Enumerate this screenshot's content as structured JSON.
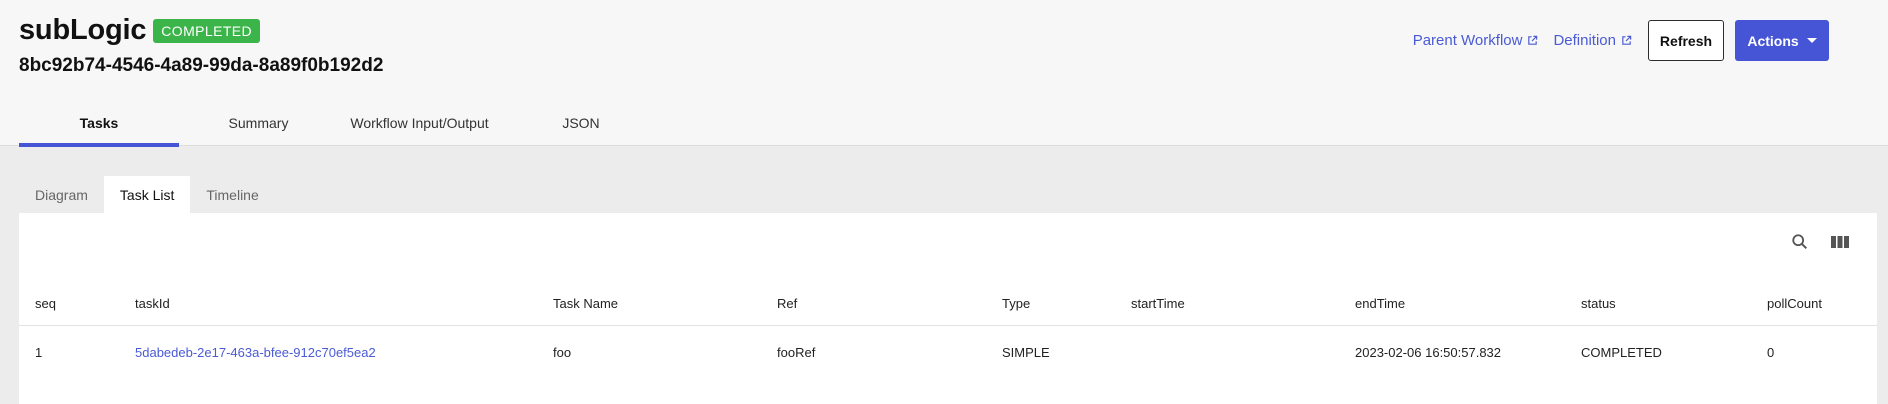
{
  "workflow": {
    "name": "subLogic",
    "status": "COMPLETED",
    "id": "8bc92b74-4546-4a89-99da-8a89f0b192d2"
  },
  "header_actions": {
    "parent_workflow": "Parent Workflow",
    "definition": "Definition",
    "refresh": "Refresh",
    "actions": "Actions"
  },
  "main_tabs": [
    "Tasks",
    "Summary",
    "Workflow Input/Output",
    "JSON"
  ],
  "sub_tabs": [
    "Diagram",
    "Task List",
    "Timeline"
  ],
  "toolbar": {
    "search_icon": "search-icon",
    "columns_icon": "view-column-icon"
  },
  "table": {
    "columns": [
      "seq",
      "taskId",
      "Task Name",
      "Ref",
      "Type",
      "startTime",
      "endTime",
      "status",
      "pollCount"
    ],
    "rows": [
      {
        "seq": "1",
        "taskId": "5dabedeb-2e17-463a-bfee-912c70ef5ea2",
        "taskName": "foo",
        "ref": "fooRef",
        "type": "SIMPLE",
        "startTime": "",
        "endTime": "2023-02-06 16:50:57.832",
        "status": "COMPLETED",
        "pollCount": "0"
      }
    ]
  },
  "colors": {
    "accent": "#4655d6",
    "link": "#4a5bd4",
    "completed_badge": "#3bb54a"
  }
}
